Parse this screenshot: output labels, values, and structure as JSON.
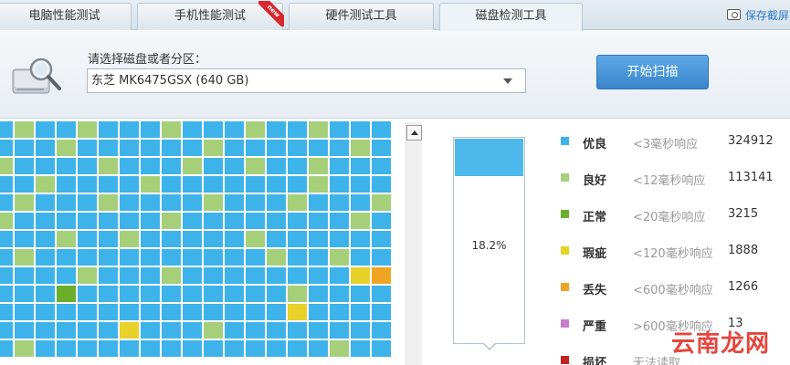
{
  "tabs": [
    {
      "label": "电脑性能测试",
      "active": false
    },
    {
      "label": "手机性能测试",
      "active": false,
      "badge": "new"
    },
    {
      "label": "硬件测试工具",
      "active": false
    },
    {
      "label": "磁盘检测工具",
      "active": true
    }
  ],
  "save_screenshot": "保存截屏",
  "disk_prompt": "请选择磁盘或者分区：",
  "disk_selected": "东芝  MK6475GSX  (640 GB)",
  "scan_button": "开始扫描",
  "progress": {
    "percent_text": "18.2%",
    "fraction": 0.182
  },
  "legend": [
    {
      "name": "优良",
      "desc": "<3毫秒响应",
      "count": "324912",
      "color": "#3db3ea"
    },
    {
      "name": "良好",
      "desc": "<12毫秒响应",
      "count": "113141",
      "color": "#a6cf7a"
    },
    {
      "name": "正常",
      "desc": "<20毫秒响应",
      "count": "3215",
      "color": "#6aae2b"
    },
    {
      "name": "瑕疵",
      "desc": "<120毫秒响应",
      "count": "1888",
      "color": "#e8d22a"
    },
    {
      "name": "丢失",
      "desc": "<600毫秒响应",
      "count": "1266",
      "color": "#f0a423"
    },
    {
      "name": "严重",
      "desc": ">600毫秒响应",
      "count": "13",
      "color": "#c67ec9"
    },
    {
      "name": "损坏",
      "desc": "无法读取",
      "count": "",
      "color": "#c62222"
    }
  ],
  "block_colors": {
    "B": "#3db3ea",
    "G": "#a6cf7a",
    "N": "#6aae2b",
    "Y": "#e8d22a",
    "O": "#f0a423"
  },
  "block_map": [
    "BGBBGBBBGBBBGBBGBBB",
    "BBBGBBBBBBGBBBBBBGB",
    "GBBBBGBBBGBBGBBGBBB",
    "BBGBBBBGBBBBBBBGBBB",
    "BGBBBGBBBBGBBBGBBBG",
    "GBBBBBBBGBBBBBBBBGB",
    "BBBGBBGBBBBBGBBBBBB",
    "BGBBBBBBBBBBBGBBGBB",
    "BBBBGBBBGBBBBBBBBYO",
    "BBBNBBBBBBBBBBGBBBB",
    "BBBBBBBBBBBBBBYBBBB",
    "BBBBBBYBBBGBBBBBBBB",
    "BGBBBBBBBBBBBBBBGBB"
  ],
  "watermark": "云南龙网"
}
